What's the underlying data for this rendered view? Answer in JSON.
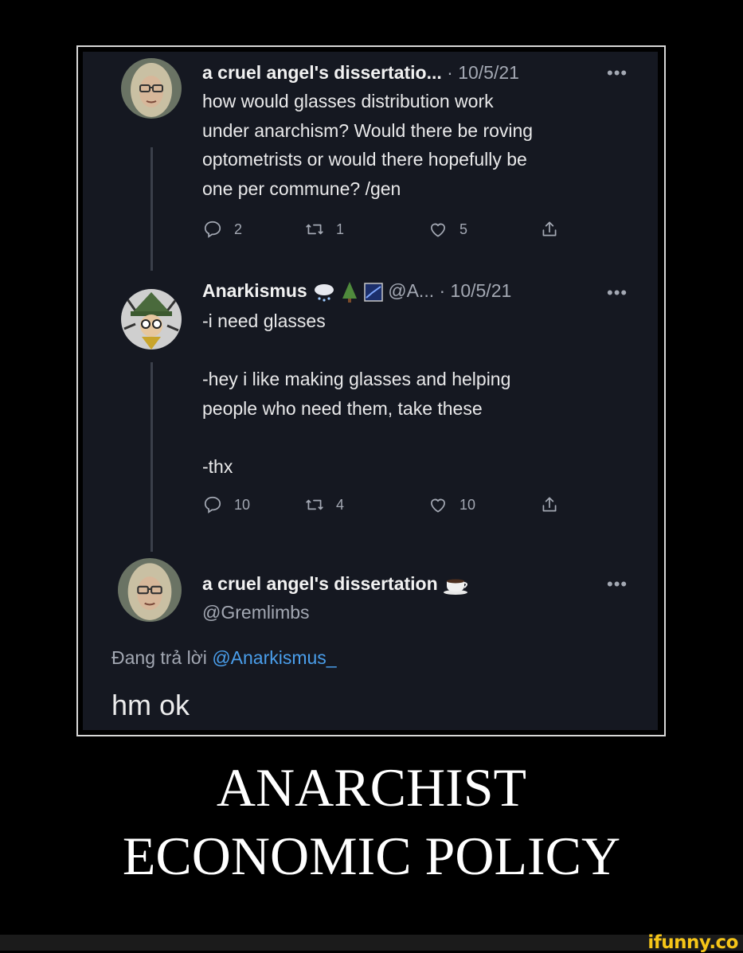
{
  "tweet1": {
    "name": "a cruel angel's dissertatio...",
    "date": "· 10/5/21",
    "more": "•••",
    "text_lines": [
      "how would glasses distribution work",
      "under anarchism? Would there be roving",
      "optometrists or would there hopefully be",
      "one per commune? /gen"
    ],
    "replies": "2",
    "retweets": "1",
    "likes": "5"
  },
  "tweet2": {
    "name": "Anarkismus",
    "handle": "@A...",
    "date": "· 10/5/21",
    "more": "•••",
    "line1": "-i need glasses",
    "line2": "-hey i like making glasses and helping",
    "line3": "people who need them, take these",
    "line4": "-thx",
    "replies": "10",
    "retweets": "4",
    "likes": "10"
  },
  "tweet3": {
    "name": "a cruel angel's dissertation",
    "handle": "@Gremlimbs",
    "more": "•••",
    "replying_prefix": "Đang trả lời",
    "replying_to": "@Anarkismus_",
    "text": "hm ok"
  },
  "caption": {
    "line1": "ANARCHIST",
    "line2": "ECONOMIC POLICY"
  },
  "watermark": "ifunny.co",
  "colors": {
    "panel_bg": "#151821",
    "link": "#4a9eeb",
    "muted": "#a3a8b3",
    "watermark": "#f5c518"
  },
  "icons": [
    "reply-icon",
    "retweet-icon",
    "like-icon",
    "share-icon",
    "cloud-snow-emoji-icon",
    "tree-emoji-icon",
    "night-sky-emoji-icon",
    "coffee-emoji-icon"
  ]
}
